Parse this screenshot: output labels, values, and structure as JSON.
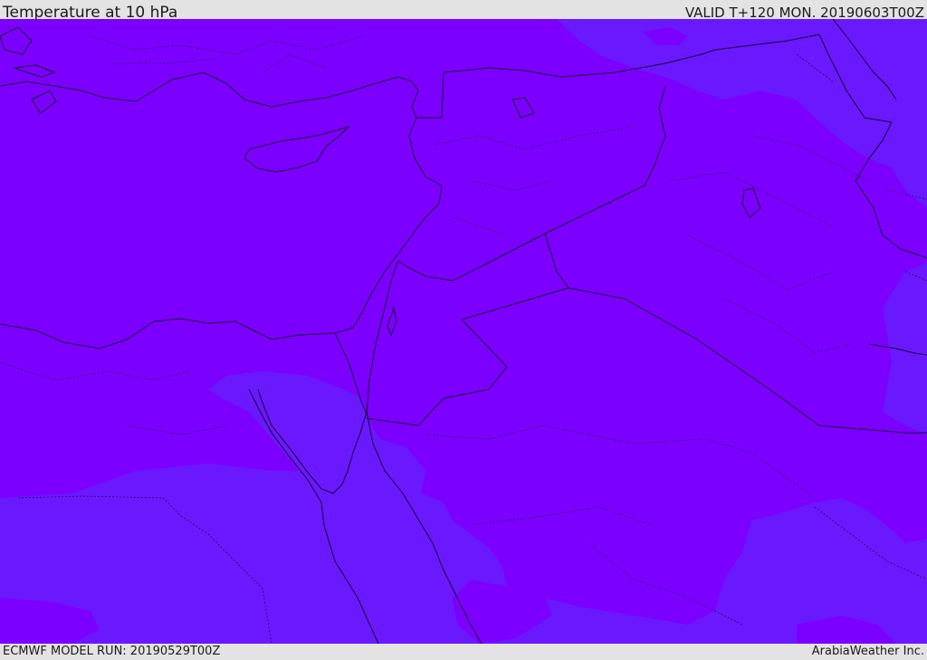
{
  "header": {
    "title": "Temperature at 10 hPa",
    "valid_time": "VALID T+120 MON. 20190603T00Z"
  },
  "footer": {
    "model_run": "ECMWF MODEL RUN: 20190529T00Z",
    "credit": "ArabiaWeather Inc."
  },
  "map": {
    "colors": {
      "fill_warm": "#7c00ff",
      "fill_cool": "#6a19ff",
      "coastline": "#1a0033",
      "border": "#1a0033"
    }
  }
}
